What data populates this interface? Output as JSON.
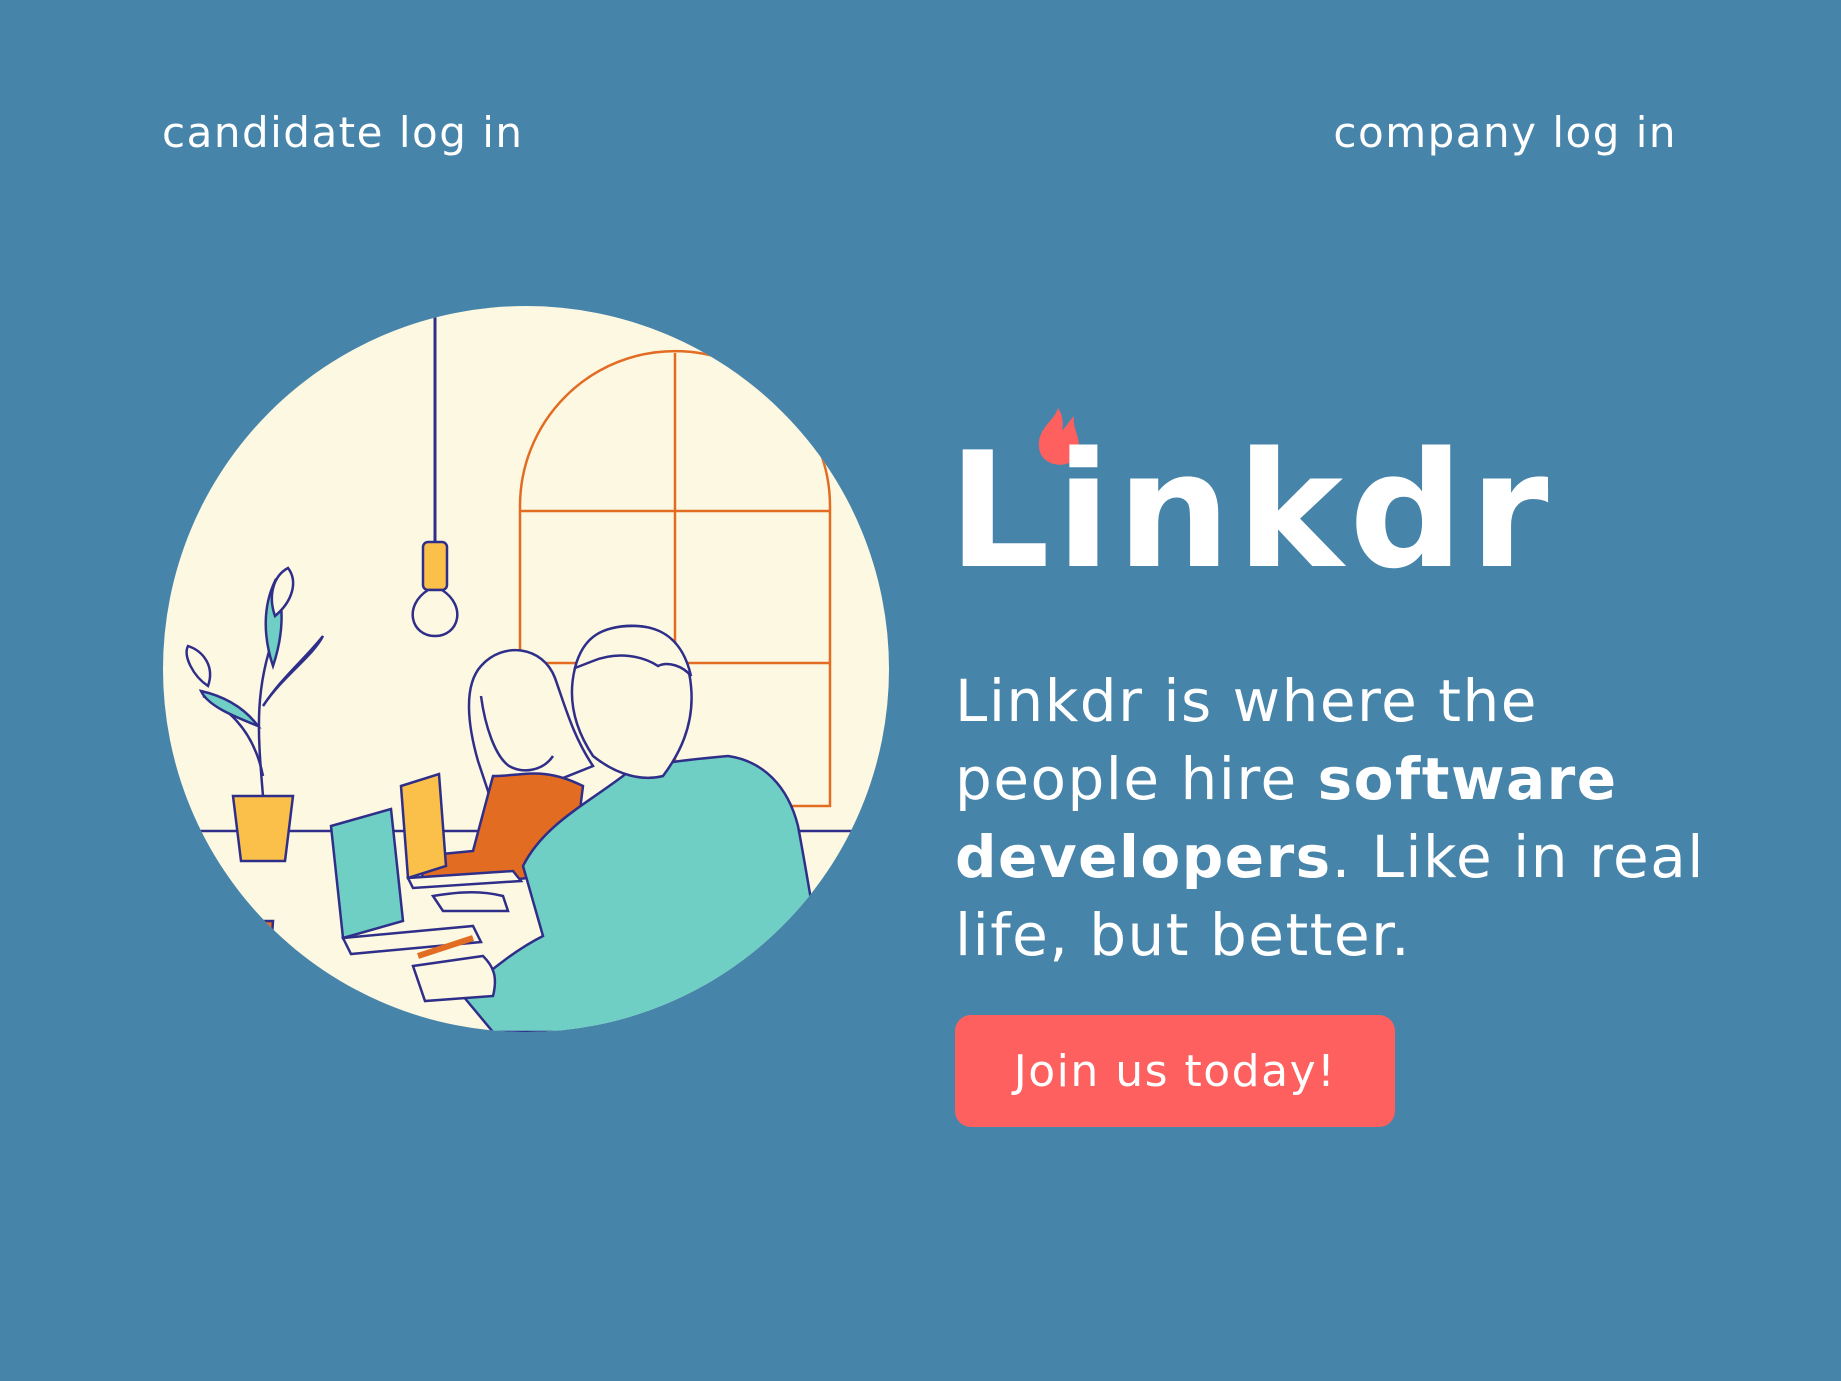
{
  "nav": {
    "candidate_login": "candidate log in",
    "company_login": "company log in"
  },
  "brand": {
    "name": "Linkdr",
    "logo_icon": "flame-icon",
    "accent_color": "#fd605e"
  },
  "hero": {
    "tagline_part1": "Linkdr is where the people hire ",
    "tagline_bold": "software developers",
    "tagline_part2": ". Like in real life, but better.",
    "cta_label": "Join us today!",
    "illustration_icon": "coworkers-at-desk-illustration"
  },
  "colors": {
    "background": "#4784aa",
    "cta_background": "#fd605e",
    "illustration_background": "#fdf8e2"
  }
}
